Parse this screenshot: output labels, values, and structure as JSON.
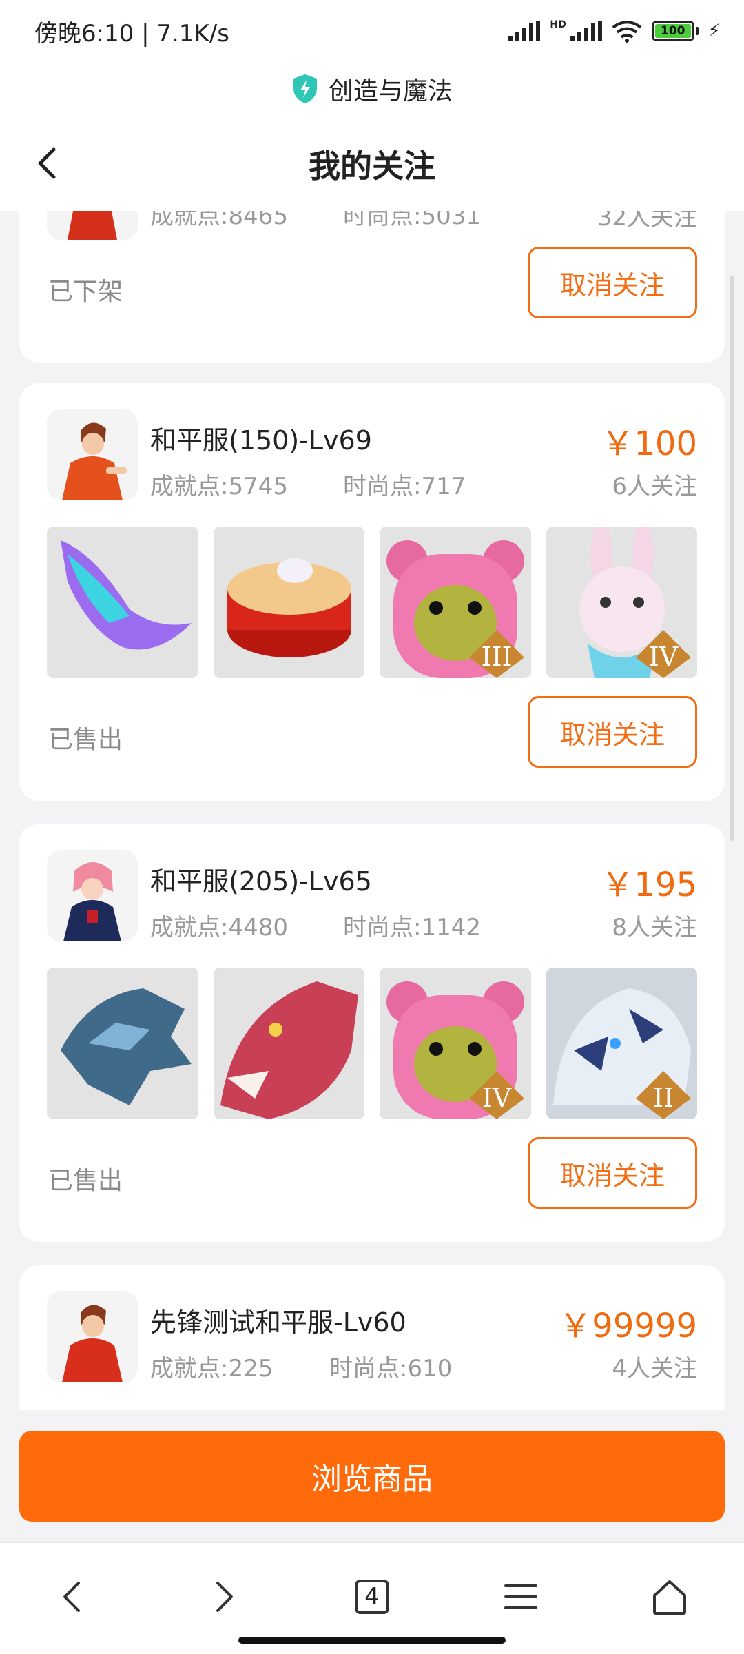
{
  "status_bar": {
    "time_speed": "傍晚6:10 | 7.1K/s",
    "hd": "HD",
    "battery": "100"
  },
  "site": {
    "name": "创造与魔法",
    "icon": "shield-bolt-icon",
    "accent": "#2fc6b5"
  },
  "nav": {
    "title": "我的关注",
    "back_icon": "chevron-left-icon"
  },
  "cards": [
    {
      "achievement": "成就点:8465",
      "fashion": "时尚点:5031",
      "follows": "32人关注",
      "status": "已下架",
      "unfollow_label": "取消关注"
    },
    {
      "title": "和平服(150)-Lv69",
      "achievement": "成就点:5745",
      "fashion": "时尚点:717",
      "price": "￥100",
      "follows": "6人关注",
      "status": "已售出",
      "unfollow_label": "取消关注",
      "thumb_badges": [
        "",
        "",
        "III",
        "IV"
      ]
    },
    {
      "title": "和平服(205)-Lv65",
      "achievement": "成就点:4480",
      "fashion": "时尚点:1142",
      "price": "￥195",
      "follows": "8人关注",
      "status": "已售出",
      "unfollow_label": "取消关注",
      "thumb_badges": [
        "",
        "",
        "IV",
        "II"
      ]
    },
    {
      "title": "先锋测试和平服-Lv60",
      "achievement": "成就点:225",
      "fashion": "时尚点:610",
      "price": "￥99999",
      "follows": "4人关注"
    }
  ],
  "browse_button": "浏览商品",
  "browser_bar": {
    "tab_count": "4"
  },
  "colors": {
    "primary": "#ff6a0a",
    "price": "#f06a0f",
    "muted": "#999999"
  }
}
